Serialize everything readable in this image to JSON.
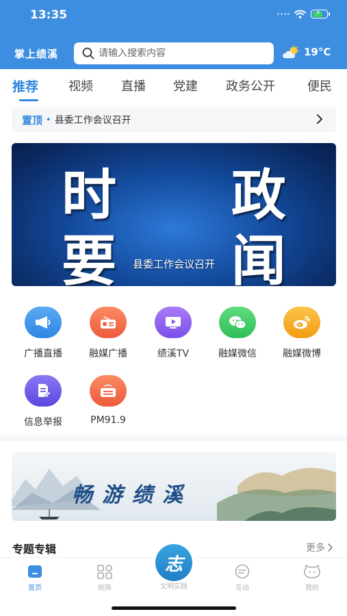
{
  "status_bar": {
    "time": "13:35"
  },
  "header": {
    "app_title": "掌上绩溪",
    "search": {
      "placeholder": "请输入搜索内容",
      "value": ""
    },
    "weather": {
      "icon": "partly-cloudy-icon",
      "temperature": "19°C"
    }
  },
  "tabs": [
    {
      "label": "推荐",
      "active": true
    },
    {
      "label": "视频",
      "active": false
    },
    {
      "label": "直播",
      "active": false
    },
    {
      "label": "党建",
      "active": false
    },
    {
      "label": "政务公开",
      "active": false
    },
    {
      "label": "便民",
      "active": false
    }
  ],
  "pinned": {
    "tag": "置顶",
    "dot": "•",
    "text": "县委工作会议召开"
  },
  "banner": {
    "line1": "时 政",
    "line2": "要 闻",
    "caption": "县委工作会议召开"
  },
  "functions": [
    {
      "label": "广播直播",
      "icon": "megaphone-icon",
      "color": "#3f96ec"
    },
    {
      "label": "融媒广播",
      "icon": "radio-icon",
      "color": "#f26d4b"
    },
    {
      "label": "绩溪TV",
      "icon": "tv-play-icon",
      "color": "#8c5ef0"
    },
    {
      "label": "融媒微信",
      "icon": "wechat-icon",
      "color": "#3fca62"
    },
    {
      "label": "融媒微博",
      "icon": "weibo-icon",
      "color": "#f6ac23"
    },
    {
      "label": "信息举报",
      "icon": "report-document-icon",
      "color": "#6d5be8"
    },
    {
      "label": "PM91.9",
      "icon": "fm-radio-icon",
      "color": "#f26d4b"
    }
  ],
  "tour_banner": {
    "title": "畅游绩溪"
  },
  "topics": {
    "title": "专题专辑",
    "more": "更多"
  },
  "tabbar": {
    "items": [
      {
        "label": "首页",
        "icon": "home-icon",
        "active": true
      },
      {
        "label": "矩阵",
        "icon": "matrix-grid-icon",
        "active": false
      },
      {
        "label": "文明实践",
        "icon": "civilization-icon",
        "active": false
      },
      {
        "label": "互动",
        "icon": "chat-icon",
        "active": false
      },
      {
        "label": "我的",
        "icon": "profile-face-icon",
        "active": false
      }
    ],
    "center_glyph": "志"
  }
}
